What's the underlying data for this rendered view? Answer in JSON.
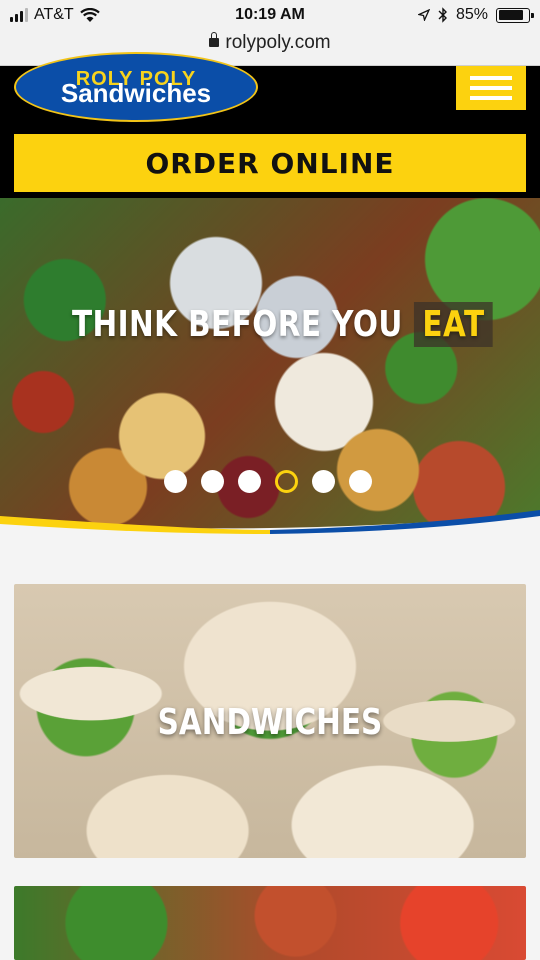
{
  "status_bar": {
    "carrier": "AT&T",
    "time": "10:19 AM",
    "battery_percent": "85%",
    "battery_level": 0.85
  },
  "browser": {
    "url": "rolypoly.com"
  },
  "header": {
    "logo_top_text": "ROLY POLY",
    "logo_text": "Sandwiches",
    "order_button_label": "ORDER ONLINE"
  },
  "hero": {
    "title": "THINK BEFORE YOU",
    "highlight": "EAT",
    "slide_count": 6,
    "active_slide": 4
  },
  "categories": [
    {
      "label": "SANDWICHES"
    },
    {
      "label": ""
    }
  ],
  "colors": {
    "brand_yellow": "#fcd20f",
    "brand_blue": "#0b4ea8",
    "header_bg": "#000000"
  }
}
